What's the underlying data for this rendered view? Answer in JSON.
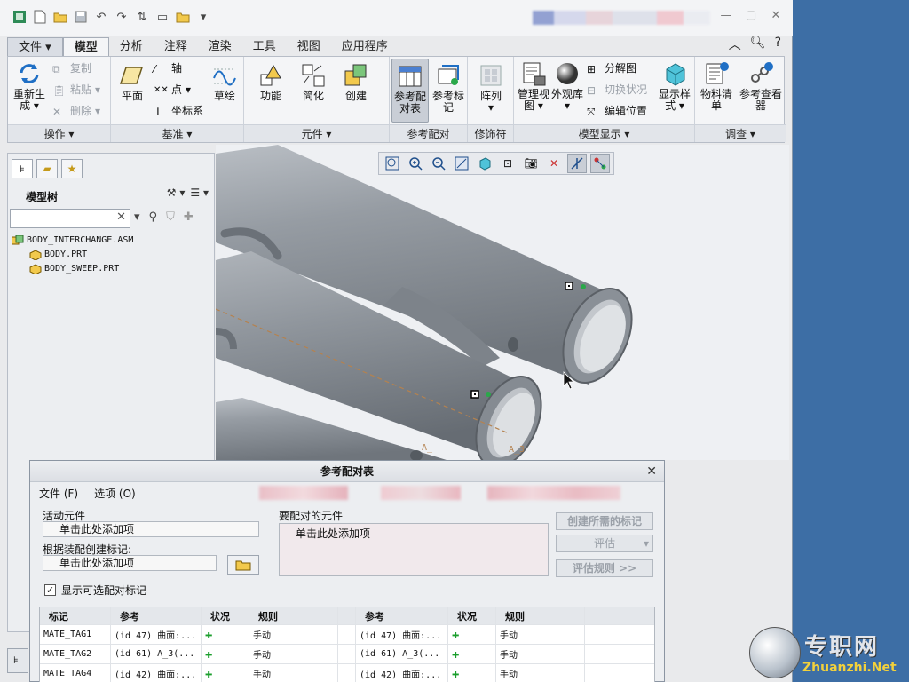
{
  "ribbon_tabs": [
    "文件",
    "模型",
    "分析",
    "注释",
    "渲染",
    "工具",
    "视图",
    "应用程序"
  ],
  "ribbon": {
    "groups": {
      "operations": "操作",
      "datum": "基准",
      "component": "元件",
      "ref_pair": "参考配对",
      "modifier": "修饰符",
      "model_display": "模型显示",
      "investigate": "调查"
    },
    "buttons": {
      "regenerate": "重新生成",
      "copy": "复制",
      "paste": "粘贴",
      "delete": "删除",
      "plane": "平面",
      "axis": "轴",
      "point": "点",
      "csys": "坐标系",
      "sketch": "草绘",
      "function": "功能",
      "simplify": "简化",
      "create": "创建",
      "ref_pair_table": "参考配对表",
      "ref_mark": "参考标记",
      "pattern": "阵列",
      "manage_views": "管理视图",
      "appearance_lib": "外观库",
      "explode_view": "分解图",
      "toggle_status": "切换状况",
      "edit_position": "编辑位置",
      "display_style": "显示样式",
      "bom": "物料清单",
      "ref_viewer": "参考查看器"
    }
  },
  "left_panel": {
    "title": "模型树",
    "search_value": "",
    "tree": [
      {
        "label": "BODY_INTERCHANGE.ASM",
        "level": 0
      },
      {
        "label": "BODY.PRT",
        "level": 1
      },
      {
        "label": "BODY_SWEEP.PRT",
        "level": 1
      }
    ]
  },
  "dialog": {
    "title": "参考配对表",
    "menu_file": "文件 (F)",
    "menu_options": "选项 (O)",
    "active_component_label": "活动元件",
    "active_component_value": "单击此处添加项",
    "create_from_assembly_label": "根据装配创建标记:",
    "create_from_assembly_value": "单击此处添加项",
    "components_to_pair_label": "要配对的元件",
    "components_to_pair_value": "单击此处添加项",
    "btn_create_marks": "创建所需的标记",
    "btn_evaluate": "评估",
    "btn_eval_rules": "评估规则 >>",
    "show_optional": "显示可选配对标记",
    "show_optional_checked": true,
    "columns": [
      "标记",
      "参考",
      "状况",
      "规则",
      "",
      "参考",
      "状况",
      "规则"
    ],
    "rows": [
      {
        "tag": "MATE_TAG1",
        "ref1": "(id 47) 曲面:...",
        "rule1": "手动",
        "ref2": "(id 47) 曲面:...",
        "rule2": "手动"
      },
      {
        "tag": "MATE_TAG2",
        "ref1": "(id 61) A_3(...",
        "rule1": "手动",
        "ref2": "(id 61) A_3(...",
        "rule2": "手动"
      },
      {
        "tag": "MATE_TAG4",
        "ref1": "(id 42) 曲面:...",
        "rule1": "手动",
        "ref2": "(id 42) 曲面:...",
        "rule2": "手动"
      }
    ]
  },
  "watermark": {
    "cn": "专职网",
    "en": "Zhuanzhi.Net"
  },
  "colors": {
    "desktop": "#3d6ea5",
    "status_ok": "#1a9e2c",
    "pipe": "#8f959c"
  }
}
